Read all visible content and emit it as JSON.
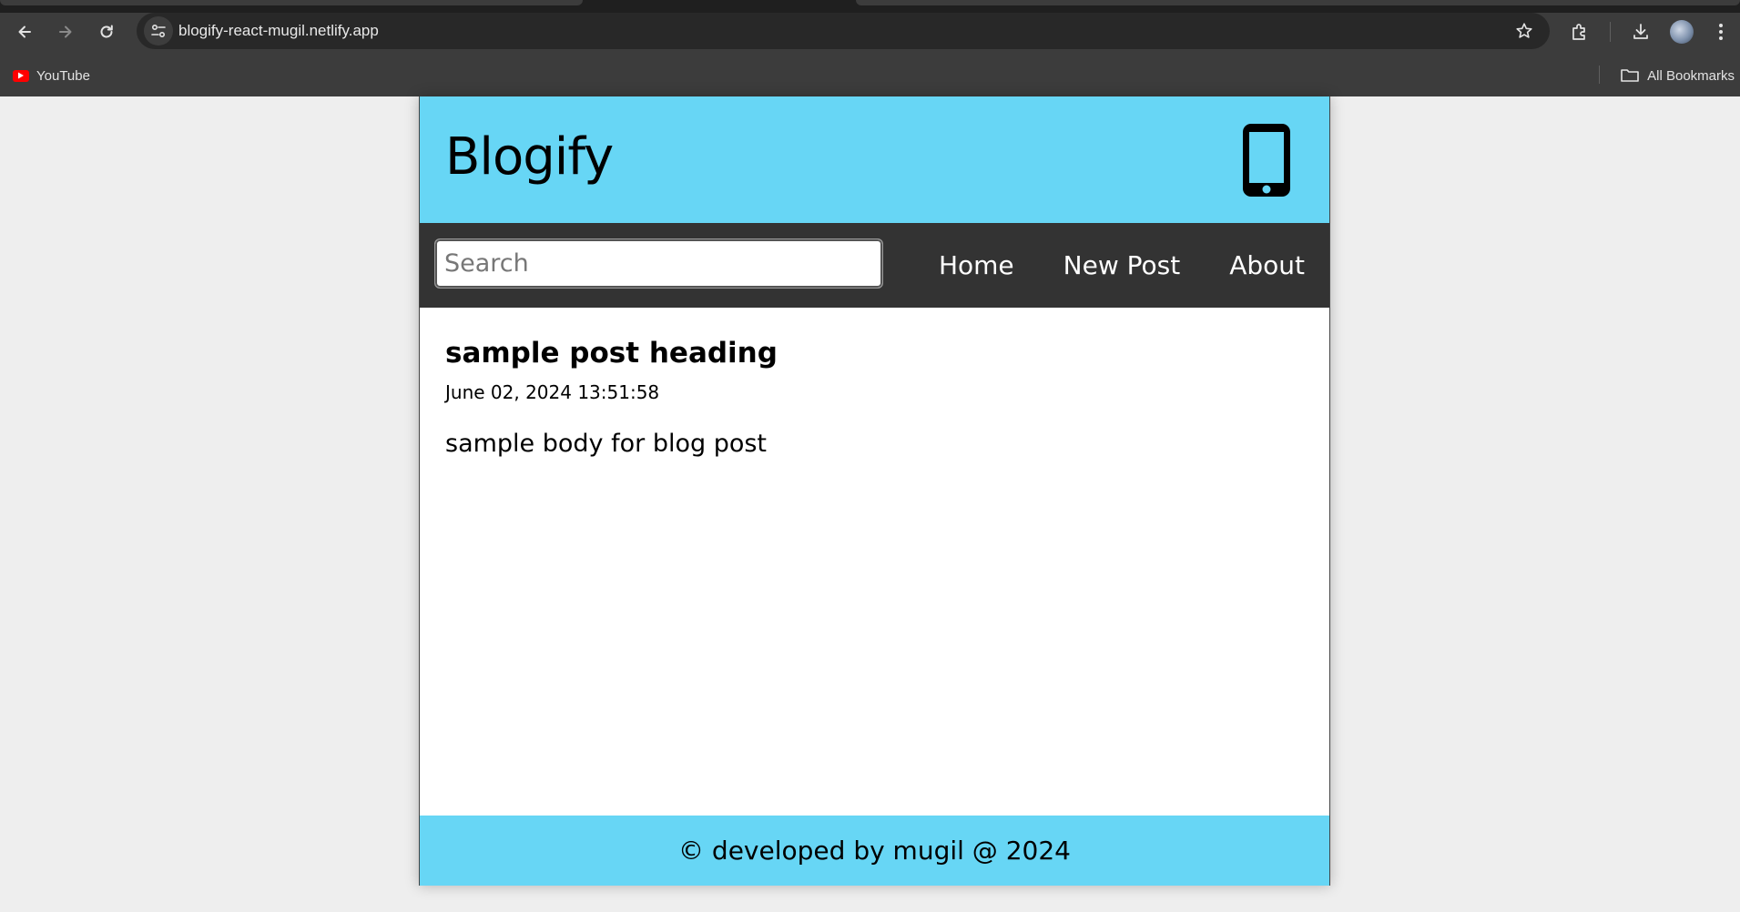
{
  "browser": {
    "url": "blogify-react-mugil.netlify.app",
    "bookmarks": {
      "items": [
        {
          "label": "YouTube",
          "icon": "youtube-icon"
        }
      ],
      "all_bookmarks_label": "All Bookmarks"
    }
  },
  "site": {
    "title": "Blogify",
    "header_icon": "mobile-phone-icon",
    "colors": {
      "accent": "#67d6f5",
      "nav": "#333333"
    },
    "search": {
      "placeholder": "Search",
      "value": ""
    },
    "nav": [
      {
        "label": "Home"
      },
      {
        "label": "New Post"
      },
      {
        "label": "About"
      }
    ],
    "posts": [
      {
        "title": "sample post heading",
        "datetime": "June 02, 2024 13:51:58",
        "body": "sample body for blog post"
      }
    ],
    "footer": "© developed by mugil @ 2024"
  }
}
